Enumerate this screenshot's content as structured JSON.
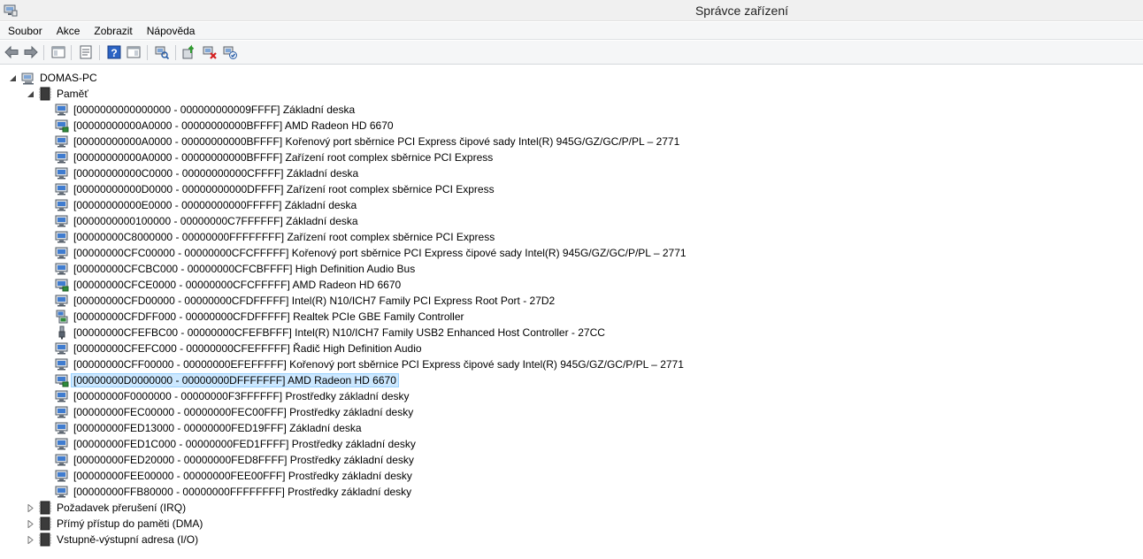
{
  "window": {
    "title": "Správce zařízení"
  },
  "menu": [
    "Soubor",
    "Akce",
    "Zobrazit",
    "Nápověda"
  ],
  "tree": {
    "root": {
      "label": "DOMAS-PC",
      "icon": "computer-icon"
    },
    "memory": {
      "label": "Paměť",
      "icon": "memory-chip-icon"
    },
    "memory_items": [
      {
        "label": "[0000000000000000 - 000000000009FFFF]  Základní deska",
        "icon": "system-device-icon"
      },
      {
        "label": "[00000000000A0000 - 00000000000BFFFF]  AMD Radeon HD 6670",
        "icon": "display-adapter-icon"
      },
      {
        "label": "[00000000000A0000 - 00000000000BFFFF]  Kořenový port sběrnice PCI Express čipové sady Intel(R) 945G/GZ/GC/P/PL – 2771",
        "icon": "system-device-icon"
      },
      {
        "label": "[00000000000A0000 - 00000000000BFFFF]  Zařízení root complex sběrnice PCI Express",
        "icon": "system-device-icon"
      },
      {
        "label": "[00000000000C0000 - 00000000000CFFFF]  Základní deska",
        "icon": "system-device-icon"
      },
      {
        "label": "[00000000000D0000 - 00000000000DFFFF]  Zařízení root complex sběrnice PCI Express",
        "icon": "system-device-icon"
      },
      {
        "label": "[00000000000E0000 - 00000000000FFFFF]  Základní deska",
        "icon": "system-device-icon"
      },
      {
        "label": "[0000000000100000 - 00000000C7FFFFFF]  Základní deska",
        "icon": "system-device-icon"
      },
      {
        "label": "[00000000C8000000 - 00000000FFFFFFFF]  Zařízení root complex sběrnice PCI Express",
        "icon": "system-device-icon"
      },
      {
        "label": "[00000000CFC00000 - 00000000CFCFFFFF]  Kořenový port sběrnice PCI Express čipové sady Intel(R) 945G/GZ/GC/P/PL – 2771",
        "icon": "system-device-icon"
      },
      {
        "label": "[00000000CFCBC000 - 00000000CFCBFFFF]  High Definition Audio Bus",
        "icon": "system-device-icon"
      },
      {
        "label": "[00000000CFCE0000 - 00000000CFCFFFFF]  AMD Radeon HD 6670",
        "icon": "display-adapter-icon"
      },
      {
        "label": "[00000000CFD00000 - 00000000CFDFFFFF]  Intel(R) N10/ICH7 Family PCI Express Root Port - 27D2",
        "icon": "system-device-icon"
      },
      {
        "label": "[00000000CFDFF000 - 00000000CFDFFFFF]  Realtek PCIe GBE Family Controller",
        "icon": "network-adapter-icon"
      },
      {
        "label": "[00000000CFEFBC00 - 00000000CFEFBFFF]  Intel(R) N10/ICH7 Family USB2 Enhanced Host Controller - 27CC",
        "icon": "usb-controller-icon"
      },
      {
        "label": "[00000000CFEFC000 - 00000000CFEFFFFF]  Řadič High Definition Audio",
        "icon": "system-device-icon"
      },
      {
        "label": "[00000000CFF00000 - 00000000EFEFFFFF]  Kořenový port sběrnice PCI Express čipové sady Intel(R) 945G/GZ/GC/P/PL – 2771",
        "icon": "system-device-icon"
      },
      {
        "label": "[00000000D0000000 - 00000000DFFFFFFF]  AMD Radeon HD 6670",
        "icon": "display-adapter-icon",
        "selected": true
      },
      {
        "label": "[00000000F0000000 - 00000000F3FFFFFF]  Prostředky základní desky",
        "icon": "system-device-icon"
      },
      {
        "label": "[00000000FEC00000 - 00000000FEC00FFF]  Prostředky základní desky",
        "icon": "system-device-icon"
      },
      {
        "label": "[00000000FED13000 - 00000000FED19FFF]  Základní deska",
        "icon": "system-device-icon"
      },
      {
        "label": "[00000000FED1C000 - 00000000FED1FFFF]  Prostředky základní desky",
        "icon": "system-device-icon"
      },
      {
        "label": "[00000000FED20000 - 00000000FED8FFFF]  Prostředky základní desky",
        "icon": "system-device-icon"
      },
      {
        "label": "[00000000FEE00000 - 00000000FEE00FFF]  Prostředky základní desky",
        "icon": "system-device-icon"
      },
      {
        "label": "[00000000FFB80000 - 00000000FFFFFFFF]  Prostředky základní desky",
        "icon": "system-device-icon"
      }
    ],
    "other_categories": [
      {
        "label": "Požadavek přerušení (IRQ)",
        "icon": "memory-chip-icon"
      },
      {
        "label": "Přímý přístup do paměti (DMA)",
        "icon": "memory-chip-icon"
      },
      {
        "label": "Vstupně-výstupní adresa (I/O)",
        "icon": "memory-chip-icon"
      }
    ]
  },
  "toolbar": [
    {
      "icon": "back-arrow-icon"
    },
    {
      "icon": "forward-arrow-icon"
    },
    {
      "icon": "console-tree-icon"
    },
    {
      "icon": "properties-icon"
    },
    {
      "icon": "help-icon"
    },
    {
      "icon": "action-pane-icon"
    },
    {
      "icon": "scan-hardware-icon"
    },
    {
      "icon": "update-driver-icon"
    },
    {
      "icon": "uninstall-device-icon"
    },
    {
      "icon": "enable-device-icon"
    }
  ]
}
